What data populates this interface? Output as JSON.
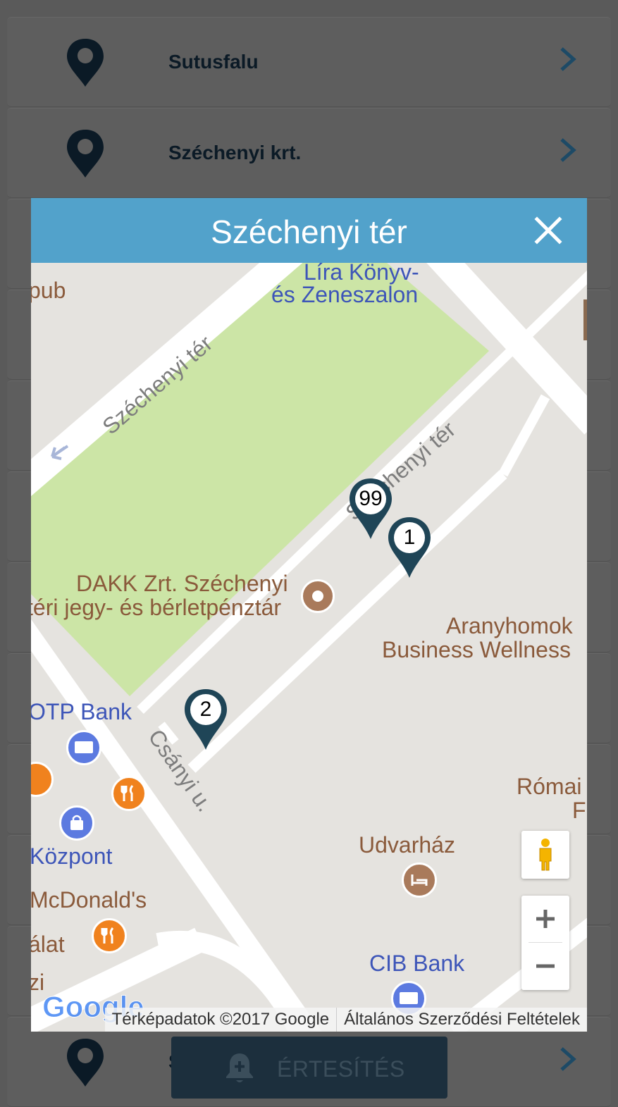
{
  "list": {
    "items": [
      {
        "label": "Sutusfalu"
      },
      {
        "label": "Széchenyi krt."
      },
      {
        "label": ""
      },
      {
        "label": ""
      },
      {
        "label": ""
      },
      {
        "label": ""
      },
      {
        "label": ""
      },
      {
        "label": ""
      },
      {
        "label": ""
      },
      {
        "label": ""
      },
      {
        "label": ""
      },
      {
        "label": "S"
      }
    ]
  },
  "modal": {
    "title": "Széchenyi tér",
    "close_icon": "close-icon"
  },
  "map": {
    "labels": {
      "pub": "pub",
      "lira_1": "Líra Könyv-",
      "lira_2": "és Zeneszalon",
      "street_szechenyi_ter_1": "Széchenyi tér",
      "street_szechenyi_ter_2": "Széchenyi tér",
      "dakk_1": "DAKK Zrt. Széchenyi",
      "dakk_2": "téri jegy- és bérletpénztár",
      "aranyhomok_1": "Aranyhomok",
      "aranyhomok_2": "Business Wellness",
      "otp": "OTP Bank",
      "csanyi": "Csányi u.",
      "romai_1": "Római",
      "romai_2": "F",
      "kozpont": "Központ",
      "udvarhaz": "Udvarház",
      "mcdonalds": "McDonald's",
      "alat": "álat",
      "zi": "zi",
      "cib": "CIB Bank",
      "google_logo": "Google"
    },
    "markers": [
      {
        "label": "99"
      },
      {
        "label": "1"
      },
      {
        "label": "2"
      }
    ],
    "attribution": {
      "data": "Térképadatok ©2017 Google",
      "terms": "Általános Szerződési Feltételek"
    },
    "controls": {
      "street_view_icon": "pegman-icon",
      "zoom_in": "+",
      "zoom_out": "−"
    },
    "colors": {
      "park": "#cce5a6",
      "road": "#ffffff",
      "land": "#e5e3df",
      "marker": "#1f4557",
      "poi_blue": "#5c7ae0",
      "poi_orange": "#f0821e",
      "poi_brown": "#a97a5b"
    }
  },
  "notify_button": {
    "label": "ÉRTESÍTÉS",
    "icon": "bell-plus-icon"
  },
  "header_accent": "#52a2cb"
}
